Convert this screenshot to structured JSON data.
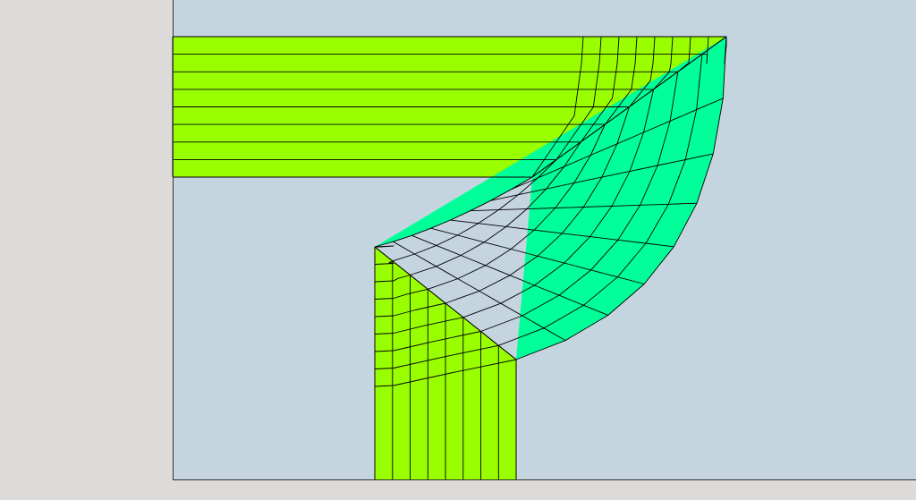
{
  "colors": {
    "app_background": "#dddbd9",
    "canvas_background": "#c5d5e0",
    "straight_region_fill": "#99ff00",
    "curved_region_fill": "#00ff99",
    "mesh_line": "#000000",
    "canvas_border": "#333333"
  },
  "mesh": {
    "horizontal_arm_rows": 8,
    "curved_band_layers": 8,
    "vertical_arm_columns": 8,
    "arc_segments": 8
  }
}
